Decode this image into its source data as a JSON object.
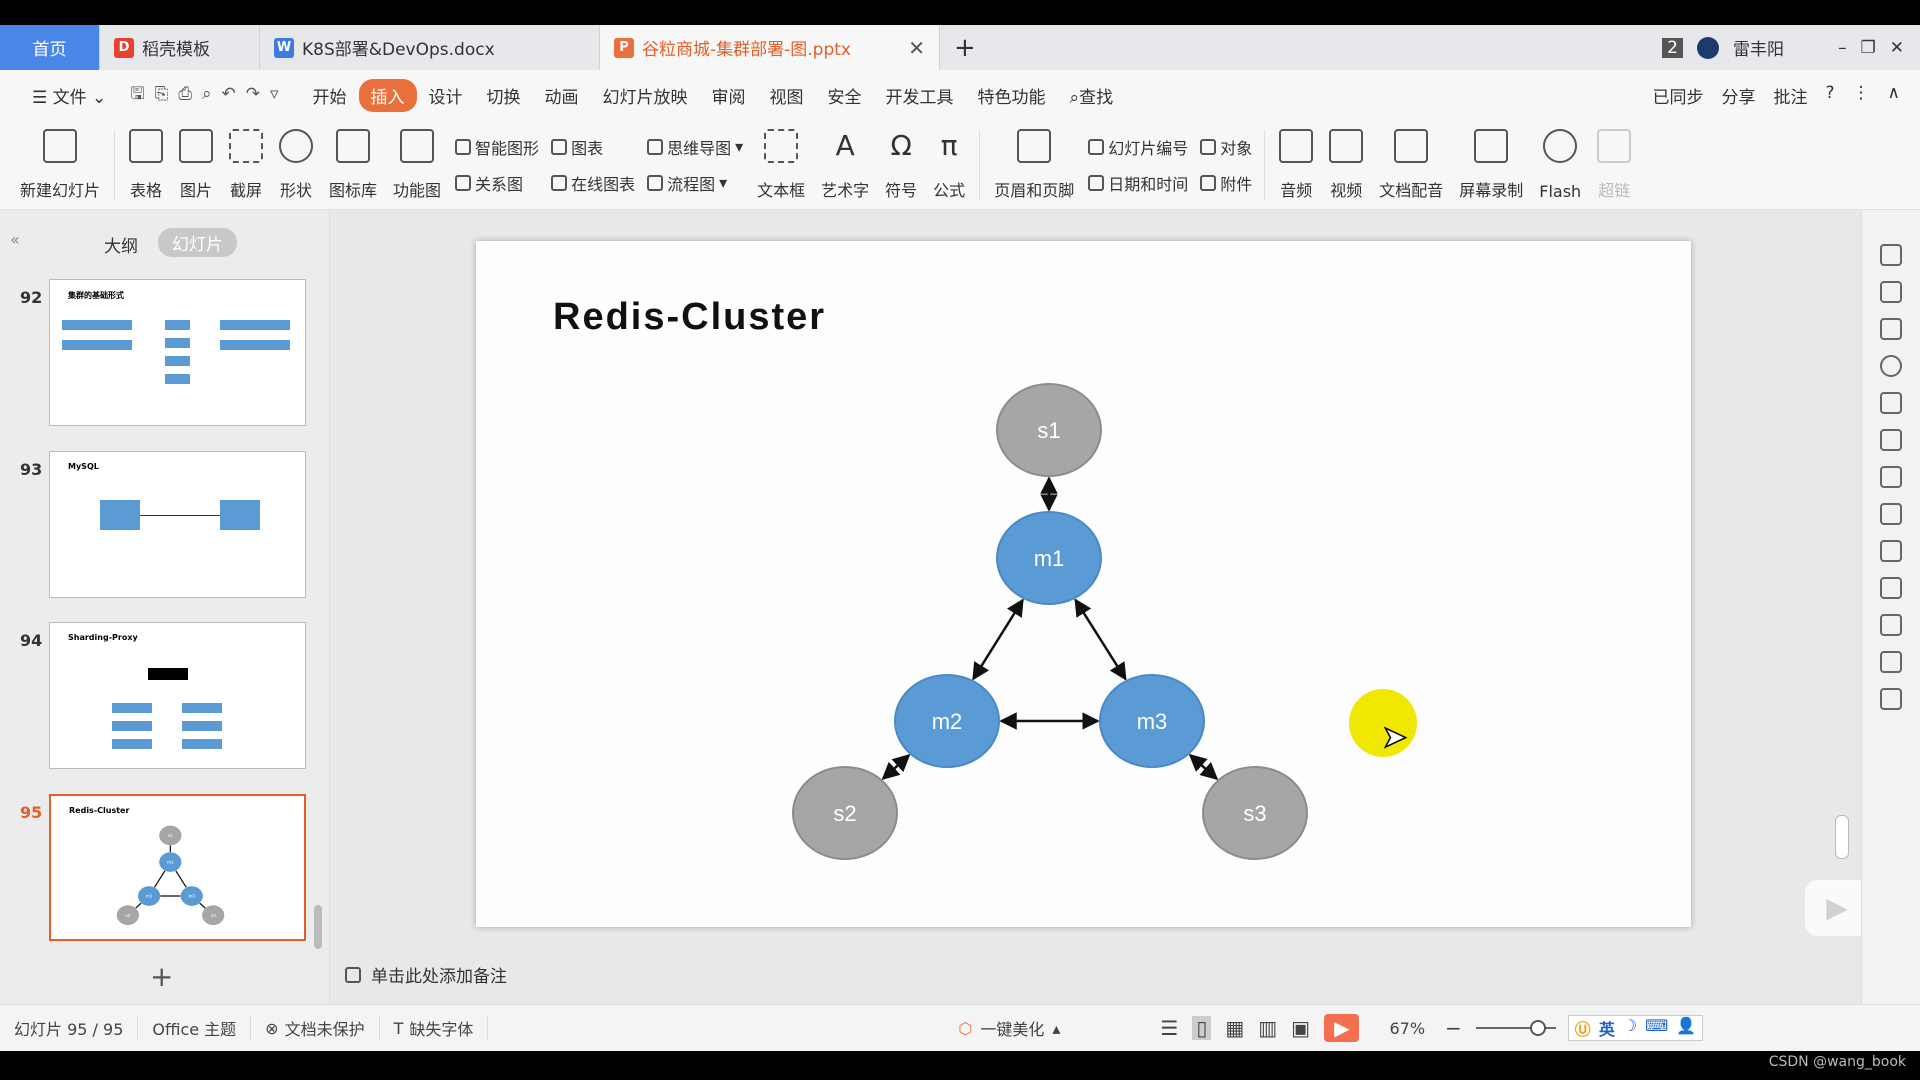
{
  "tabs": [
    {
      "label": "首页"
    },
    {
      "label": "稻壳模板"
    },
    {
      "label": "K8S部署&DevOps.docx"
    },
    {
      "label": "谷粒商城-集群部署-图.pptx"
    }
  ],
  "window": {
    "badge": "2",
    "user": "雷丰阳"
  },
  "menu": [
    "文件",
    "开始",
    "插入",
    "设计",
    "切换",
    "动画",
    "幻灯片放映",
    "审阅",
    "视图",
    "安全",
    "开发工具",
    "特色功能",
    "查找"
  ],
  "menu_right": [
    "已同步",
    "分享",
    "批注"
  ],
  "ribbon": {
    "big": [
      "新建幻灯片",
      "表格",
      "图片",
      "截屏",
      "形状",
      "图标库",
      "功能图"
    ],
    "col1": [
      "智能图形",
      "关系图"
    ],
    "col2": [
      "图表",
      "在线图表"
    ],
    "col3": [
      "思维导图",
      "流程图"
    ],
    "big2": [
      "文本框",
      "艺术字",
      "符号",
      "公式",
      "页眉和页脚"
    ],
    "col4": [
      "幻灯片编号",
      "日期和时间"
    ],
    "col5": [
      "对象",
      "附件"
    ],
    "big3": [
      "音频",
      "视频",
      "文档配音",
      "屏幕录制",
      "Flash",
      "超链"
    ]
  },
  "leftpanel": {
    "tabs": [
      "大纲",
      "幻灯片"
    ],
    "thumbs": [
      {
        "num": "92",
        "title": "集群的基础形式"
      },
      {
        "num": "93",
        "title": "MySQL"
      },
      {
        "num": "94",
        "title": "Sharding-Proxy"
      },
      {
        "num": "95",
        "title": "Redis-Cluster"
      }
    ]
  },
  "slide": {
    "title": "Redis-Cluster",
    "nodes": [
      {
        "label": "s1",
        "type": "slave",
        "color": "#a6a6a6"
      },
      {
        "label": "m1",
        "type": "master",
        "color": "#5b9bd5"
      },
      {
        "label": "m2",
        "type": "master",
        "color": "#5b9bd5"
      },
      {
        "label": "m3",
        "type": "master",
        "color": "#5b9bd5"
      },
      {
        "label": "s2",
        "type": "slave",
        "color": "#a6a6a6"
      },
      {
        "label": "s3",
        "type": "slave",
        "color": "#a6a6a6"
      }
    ],
    "edges": [
      [
        "s1",
        "m1"
      ],
      [
        "m1",
        "m2"
      ],
      [
        "m1",
        "m3"
      ],
      [
        "m2",
        "m3"
      ],
      [
        "m2",
        "s2"
      ],
      [
        "m3",
        "s3"
      ]
    ]
  },
  "notes_placeholder": "单击此处添加备注",
  "status": {
    "slide": "幻灯片 95 / 95",
    "theme": "Office 主题",
    "protect": "文档未保护",
    "font": "缺失字体",
    "beautify": "一键美化",
    "zoom": "67%"
  },
  "watermark": "CSDN @wang_book",
  "ime": "英"
}
